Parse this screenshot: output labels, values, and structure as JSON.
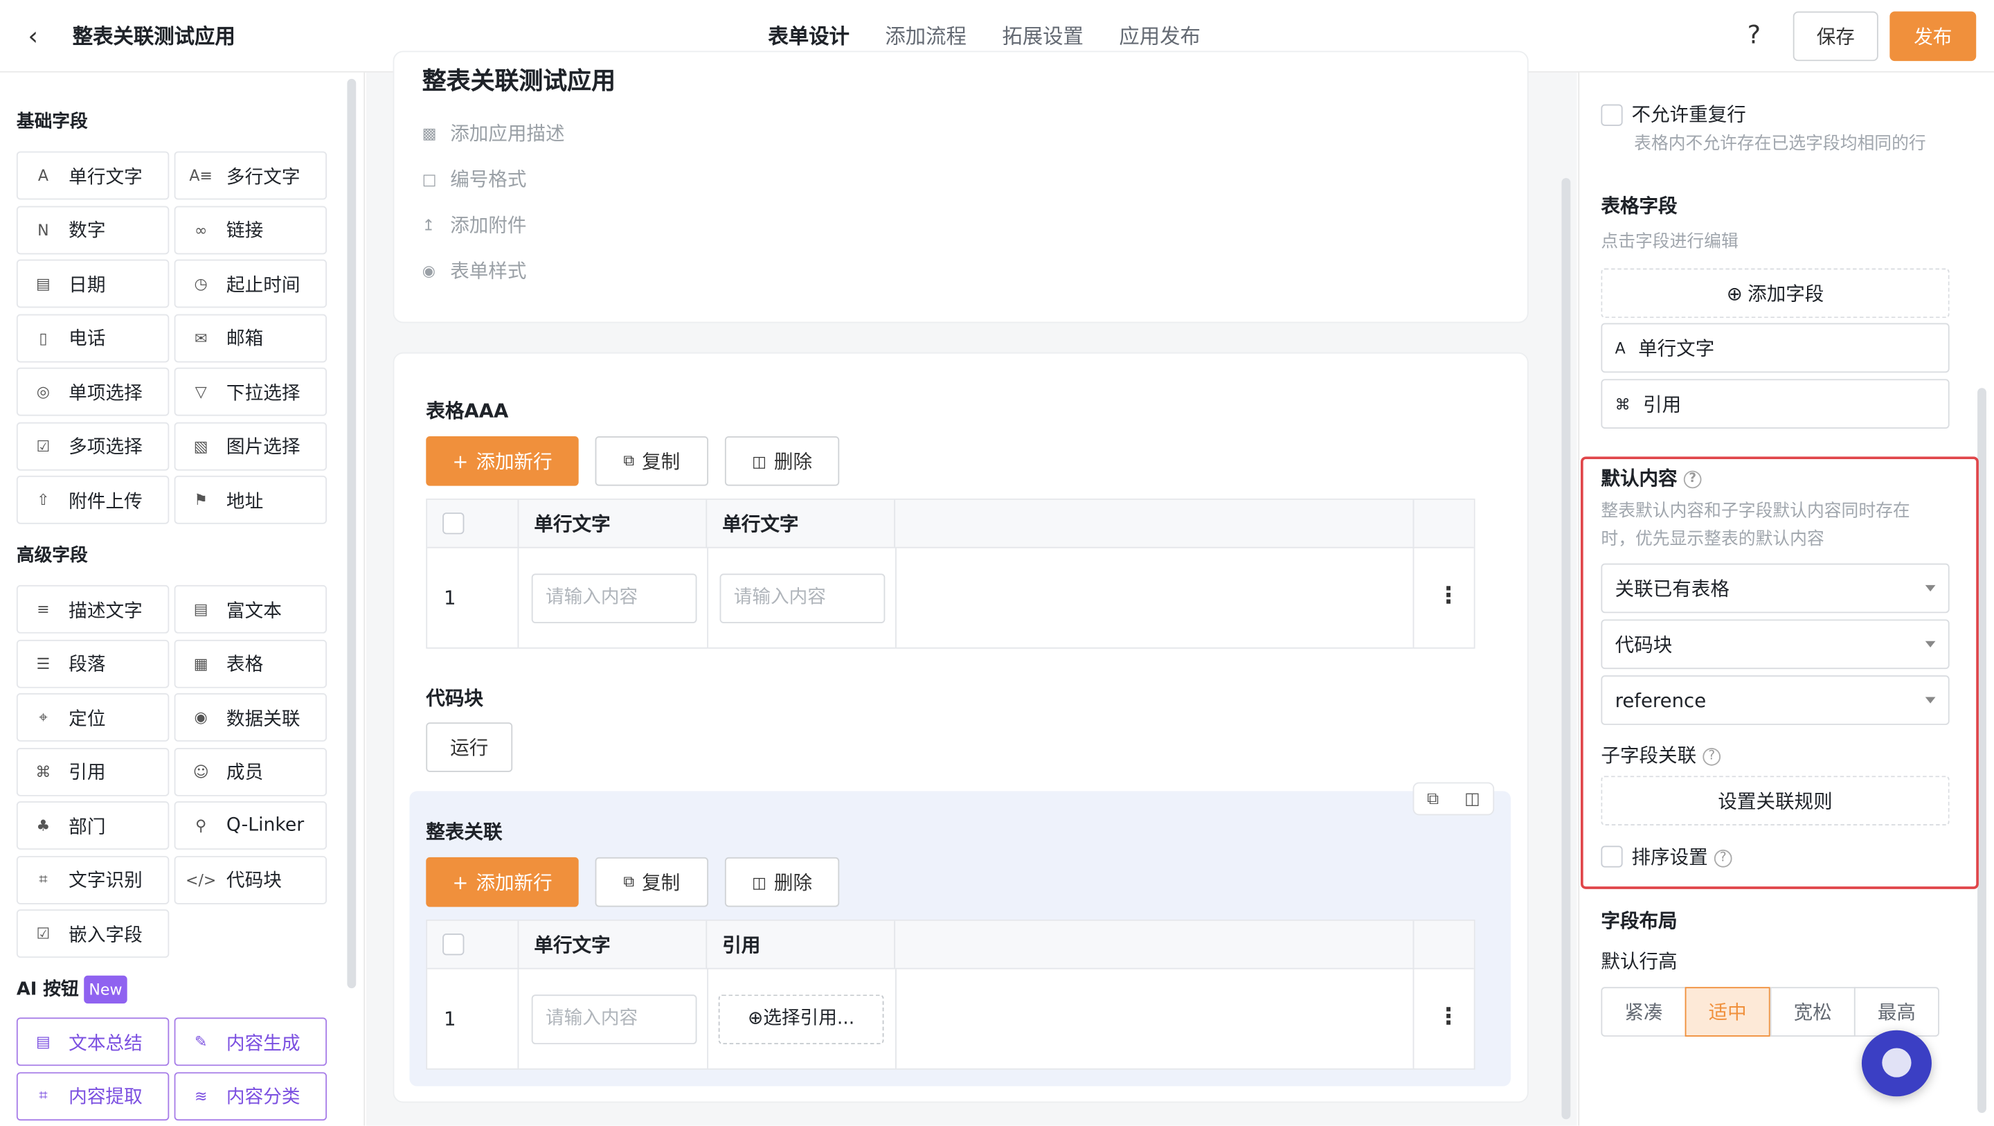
{
  "header": {
    "back_icon": "chevron-left-icon",
    "title": "整表关联测试应用",
    "tabs": [
      "表单设计",
      "添加流程",
      "拓展设置",
      "应用发布"
    ],
    "help": "?",
    "save": "保存",
    "publish": "发布"
  },
  "left": {
    "basic_title": "基础字段",
    "basic": [
      "单行文字",
      "多行文字",
      "数字",
      "链接",
      "日期",
      "起止时间",
      "电话",
      "邮箱",
      "单项选择",
      "下拉选择",
      "多项选择",
      "图片选择",
      "附件上传",
      "地址"
    ],
    "adv_title": "高级字段",
    "adv": [
      "描述文字",
      "富文本",
      "段落",
      "表格",
      "定位",
      "数据关联",
      "引用",
      "成员",
      "部门",
      "Q-Linker",
      "文字识别",
      "代码块",
      "嵌入字段"
    ],
    "ai_title": "AI 按钮",
    "ai_badge": "New",
    "ai": [
      "文本总结",
      "内容生成",
      "内容提取",
      "内容分类"
    ]
  },
  "form": {
    "title": "整表关联测试应用",
    "options": [
      "添加应用描述",
      "编号格式",
      "添加附件",
      "表单样式"
    ]
  },
  "table1": {
    "name": "表格AAA",
    "add": "添加新行",
    "copy": "复制",
    "del": "删除",
    "cols": [
      "单行文字",
      "单行文字"
    ],
    "row": "1",
    "ph": "请输入内容"
  },
  "code": {
    "name": "代码块",
    "run": "运行"
  },
  "table2": {
    "name": "整表关联",
    "add": "添加新行",
    "copy": "复制",
    "del": "删除",
    "cols": [
      "单行文字",
      "引用"
    ],
    "row": "1",
    "ph": "请输入内容",
    "ref": "⊕选择引用..."
  },
  "right": {
    "top_check": "不允许重复行",
    "top_desc": "表格内不允许存在已选字段均相同的行",
    "fields_title": "表格字段",
    "fields_sub": "点击字段进行编辑",
    "add_field": "添加字段",
    "fields": [
      "单行文字",
      "引用"
    ],
    "default_title": "默认内容",
    "default_desc1": "整表默认内容和子字段默认内容同时存在",
    "default_desc2": "时，优先显示整表的默认内容",
    "selects": [
      "关联已有表格",
      "代码块",
      "reference"
    ],
    "sub_title": "子字段关联",
    "rule_btn": "设置关联规则",
    "sort": "排序设置",
    "layout_title": "字段布局",
    "row_h": "默认行高",
    "heights": [
      "紧凑",
      "适中",
      "宽松",
      "最高"
    ],
    "active_height": "适中"
  },
  "colors": {
    "accent": "#f0903c",
    "ai": "#7b4fe0",
    "highlight": "#e0464a"
  }
}
